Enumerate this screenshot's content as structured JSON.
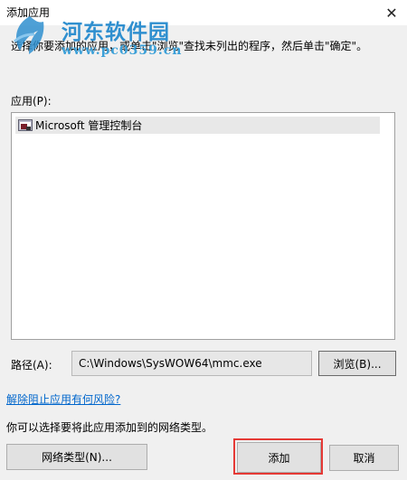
{
  "window": {
    "title": "添加应用"
  },
  "watermark": {
    "site_name": "河东软件园",
    "url": "www.pc0359.cn"
  },
  "instruction": "选择你要添加的应用，或单击\"浏览\"查找未列出的程序，然后单击\"确定\"。",
  "apps": {
    "label": "应用(P):",
    "items": [
      {
        "label": "Microsoft 管理控制台",
        "icon": "mmc-app-icon"
      }
    ]
  },
  "path": {
    "label": "路径(A):",
    "value": "C:\\Windows\\SysWOW64\\mmc.exe",
    "browse_label": "浏览(B)..."
  },
  "risk_link": "解除阻止应用有何风险?",
  "network": {
    "hint": "你可以选择要将此应用添加到的网络类型。",
    "button_label": "网络类型(N)..."
  },
  "buttons": {
    "add_label": "添加",
    "cancel_label": "取消"
  },
  "colors": {
    "link": "#0066cc",
    "highlight": "#e53935",
    "watermark": "#2f8fcf"
  }
}
